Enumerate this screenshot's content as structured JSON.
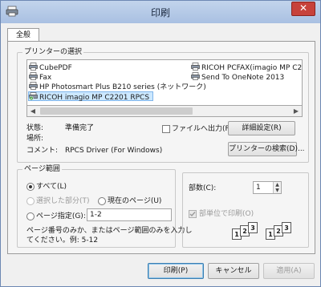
{
  "window": {
    "title": "印刷",
    "close_label": "✕"
  },
  "tabs": [
    {
      "label": "全般"
    }
  ],
  "printer_select": {
    "label": "プリンターの選択",
    "printers": [
      {
        "name": "CubePDF"
      },
      {
        "name": "Fax"
      },
      {
        "name": "HP Photosmart Plus B210 series (ネットワーク)"
      },
      {
        "name": "RICOH imagio MP C2201 RPCS",
        "selected": true
      },
      {
        "name": "RICOH PCFAX(imagio MP C2"
      },
      {
        "name": "Send To OneNote 2013"
      }
    ],
    "scroll_left": "◀",
    "scroll_right": "▶"
  },
  "status": {
    "status_label": "状態:",
    "status_value": "準備完了",
    "location_label": "場所:",
    "location_value": "",
    "comment_label": "コメント:",
    "comment_value": "RPCS Driver (For Windows)",
    "print_to_file_label": "ファイルへ出力(F)",
    "advanced_button": "詳細設定(R)",
    "find_printer_button": "プリンターの検索(D)..."
  },
  "page_range": {
    "label": "ページ範囲",
    "all_label": "すべて(L)",
    "selection_label": "選択した部分(T)",
    "current_page_label": "現在のページ(U)",
    "pages_label": "ページ指定(G):",
    "pages_value": "1-2",
    "hint_line1": "ページ番号のみか、またはページ範囲のみを入力し",
    "hint_line2": "てください。例: 5-12"
  },
  "copies": {
    "label": "部数(C):",
    "value": "1",
    "collate_label": "部単位で印刷(O)",
    "collate_pages": [
      "1",
      "2",
      "3",
      "1",
      "2",
      "3"
    ]
  },
  "buttons": {
    "print": "印刷(P)",
    "cancel": "キャンセル",
    "apply": "適用(A)"
  }
}
